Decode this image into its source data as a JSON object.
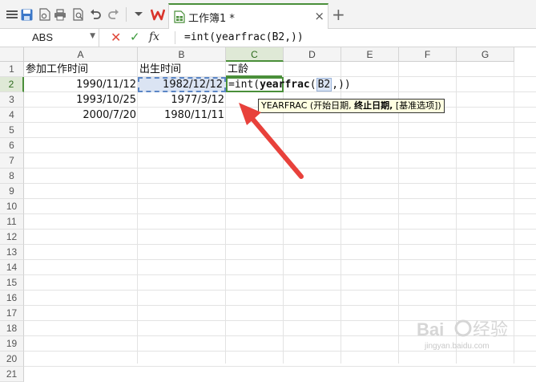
{
  "toolbar": {
    "icons": [
      "app-menu-icon",
      "save-icon",
      "export-pdf-icon",
      "print-icon",
      "print-preview-icon",
      "undo-icon",
      "redo-icon",
      "more-icon"
    ],
    "brand_color": "#d9342b"
  },
  "tab": {
    "title": "工作簿1 *",
    "close": "×",
    "new_tab": "+"
  },
  "formula_bar": {
    "name_box": "ABS",
    "cancel": "✕",
    "confirm": "✓",
    "fx": "fx",
    "formula": "=int(yearfrac(B2,))"
  },
  "grid": {
    "columns": [
      "A",
      "B",
      "C",
      "D",
      "E",
      "F",
      "G"
    ],
    "selected_column": "C",
    "rows": [
      "1",
      "2",
      "3",
      "4",
      "5",
      "6",
      "7",
      "8",
      "9",
      "10",
      "11",
      "12",
      "13",
      "14",
      "15",
      "16",
      "17",
      "18",
      "19",
      "20",
      "21"
    ],
    "selected_row": "2",
    "cells": {
      "A1": "参加工作时间",
      "B1": "出生时间",
      "C1": "工龄",
      "A2": "1990/11/12",
      "B2": "1982/12/12",
      "A3": "1993/10/25",
      "B3": "1977/3/12",
      "A4": "2000/7/20",
      "B4": "1980/11/11"
    },
    "active_cell": {
      "prefix": "=int(",
      "func": "yearfrac",
      "open": "(",
      "ref": "B2",
      "suffix": ",))"
    }
  },
  "tooltip": {
    "name": "YEARFRAC",
    "open": " (开始日期, ",
    "bold_arg": "终止日期,",
    "rest": " [基准选项])"
  },
  "watermark": {
    "text": "jingyan.baidu.com"
  },
  "colors": {
    "accent_green": "#4a8f3a",
    "selection_blue": "#5b86c5",
    "arrow_red": "#e8413b"
  }
}
